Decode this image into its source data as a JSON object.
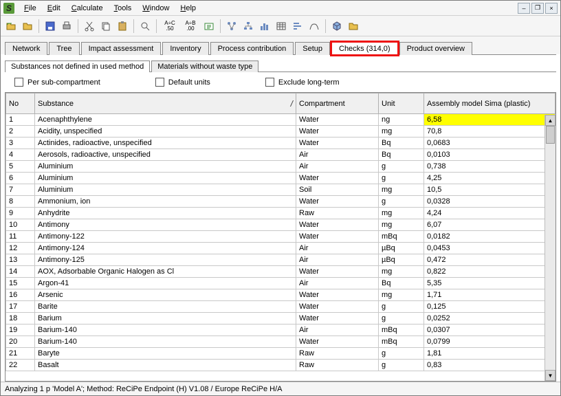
{
  "app_letter": "S",
  "menu": {
    "file": "File",
    "edit": "Edit",
    "calculate": "Calculate",
    "tools": "Tools",
    "window": "Window",
    "help": "Help"
  },
  "toolbar_text": {
    "ac50": "A÷C .50",
    "ab00": "A÷B .00"
  },
  "tabs": [
    {
      "id": "network",
      "label": "Network"
    },
    {
      "id": "tree",
      "label": "Tree"
    },
    {
      "id": "impact",
      "label": "Impact assessment"
    },
    {
      "id": "inventory",
      "label": "Inventory"
    },
    {
      "id": "process",
      "label": "Process contribution"
    },
    {
      "id": "setup",
      "label": "Setup"
    },
    {
      "id": "checks",
      "label": "Checks (314,0)"
    },
    {
      "id": "overview",
      "label": "Product overview"
    }
  ],
  "subtabs": [
    {
      "id": "subst",
      "label": "Substances not defined in used method"
    },
    {
      "id": "mat",
      "label": "Materials without waste type"
    }
  ],
  "options": {
    "per_sub": "Per sub-compartment",
    "default_units": "Default units",
    "exclude_long": "Exclude long-term"
  },
  "columns": {
    "no": "No",
    "substance": "Substance",
    "compartment": "Compartment",
    "unit": "Unit",
    "model": "Assembly model Sima (plastic)"
  },
  "rows": [
    {
      "no": "1",
      "substance": "Acenaphthylene",
      "compartment": "Water",
      "unit": "ng",
      "value": "6,58",
      "hl": true
    },
    {
      "no": "2",
      "substance": "Acidity, unspecified",
      "compartment": "Water",
      "unit": "mg",
      "value": "70,8"
    },
    {
      "no": "3",
      "substance": "Actinides, radioactive, unspecified",
      "compartment": "Water",
      "unit": "Bq",
      "value": "0,0683"
    },
    {
      "no": "4",
      "substance": "Aerosols, radioactive, unspecified",
      "compartment": "Air",
      "unit": "Bq",
      "value": "0,0103"
    },
    {
      "no": "5",
      "substance": "Aluminium",
      "compartment": "Air",
      "unit": "g",
      "value": "0,738"
    },
    {
      "no": "6",
      "substance": "Aluminium",
      "compartment": "Water",
      "unit": "g",
      "value": "4,25"
    },
    {
      "no": "7",
      "substance": "Aluminium",
      "compartment": "Soil",
      "unit": "mg",
      "value": "10,5"
    },
    {
      "no": "8",
      "substance": "Ammonium, ion",
      "compartment": "Water",
      "unit": "g",
      "value": "0,0328"
    },
    {
      "no": "9",
      "substance": "Anhydrite",
      "compartment": "Raw",
      "unit": "mg",
      "value": "4,24"
    },
    {
      "no": "10",
      "substance": "Antimony",
      "compartment": "Water",
      "unit": "mg",
      "value": "6,07"
    },
    {
      "no": "11",
      "substance": "Antimony-122",
      "compartment": "Water",
      "unit": "mBq",
      "value": "0,0182"
    },
    {
      "no": "12",
      "substance": "Antimony-124",
      "compartment": "Air",
      "unit": "µBq",
      "value": "0,0453"
    },
    {
      "no": "13",
      "substance": "Antimony-125",
      "compartment": "Air",
      "unit": "µBq",
      "value": "0,472"
    },
    {
      "no": "14",
      "substance": "AOX, Adsorbable Organic Halogen as Cl",
      "compartment": "Water",
      "unit": "mg",
      "value": "0,822"
    },
    {
      "no": "15",
      "substance": "Argon-41",
      "compartment": "Air",
      "unit": "Bq",
      "value": "5,35"
    },
    {
      "no": "16",
      "substance": "Arsenic",
      "compartment": "Water",
      "unit": "mg",
      "value": "1,71"
    },
    {
      "no": "17",
      "substance": "Barite",
      "compartment": "Water",
      "unit": "g",
      "value": "0,125"
    },
    {
      "no": "18",
      "substance": "Barium",
      "compartment": "Water",
      "unit": "g",
      "value": "0,0252"
    },
    {
      "no": "19",
      "substance": "Barium-140",
      "compartment": "Air",
      "unit": "mBq",
      "value": "0,0307"
    },
    {
      "no": "20",
      "substance": "Barium-140",
      "compartment": "Water",
      "unit": "mBq",
      "value": "0,0799"
    },
    {
      "no": "21",
      "substance": "Baryte",
      "compartment": "Raw",
      "unit": "g",
      "value": "1,81"
    },
    {
      "no": "22",
      "substance": "Basalt",
      "compartment": "Raw",
      "unit": "g",
      "value": "0,83"
    }
  ],
  "status": "Analyzing 1 p 'Model A'; Method: ReCiPe Endpoint (H) V1.08 / Europe ReCiPe H/A"
}
